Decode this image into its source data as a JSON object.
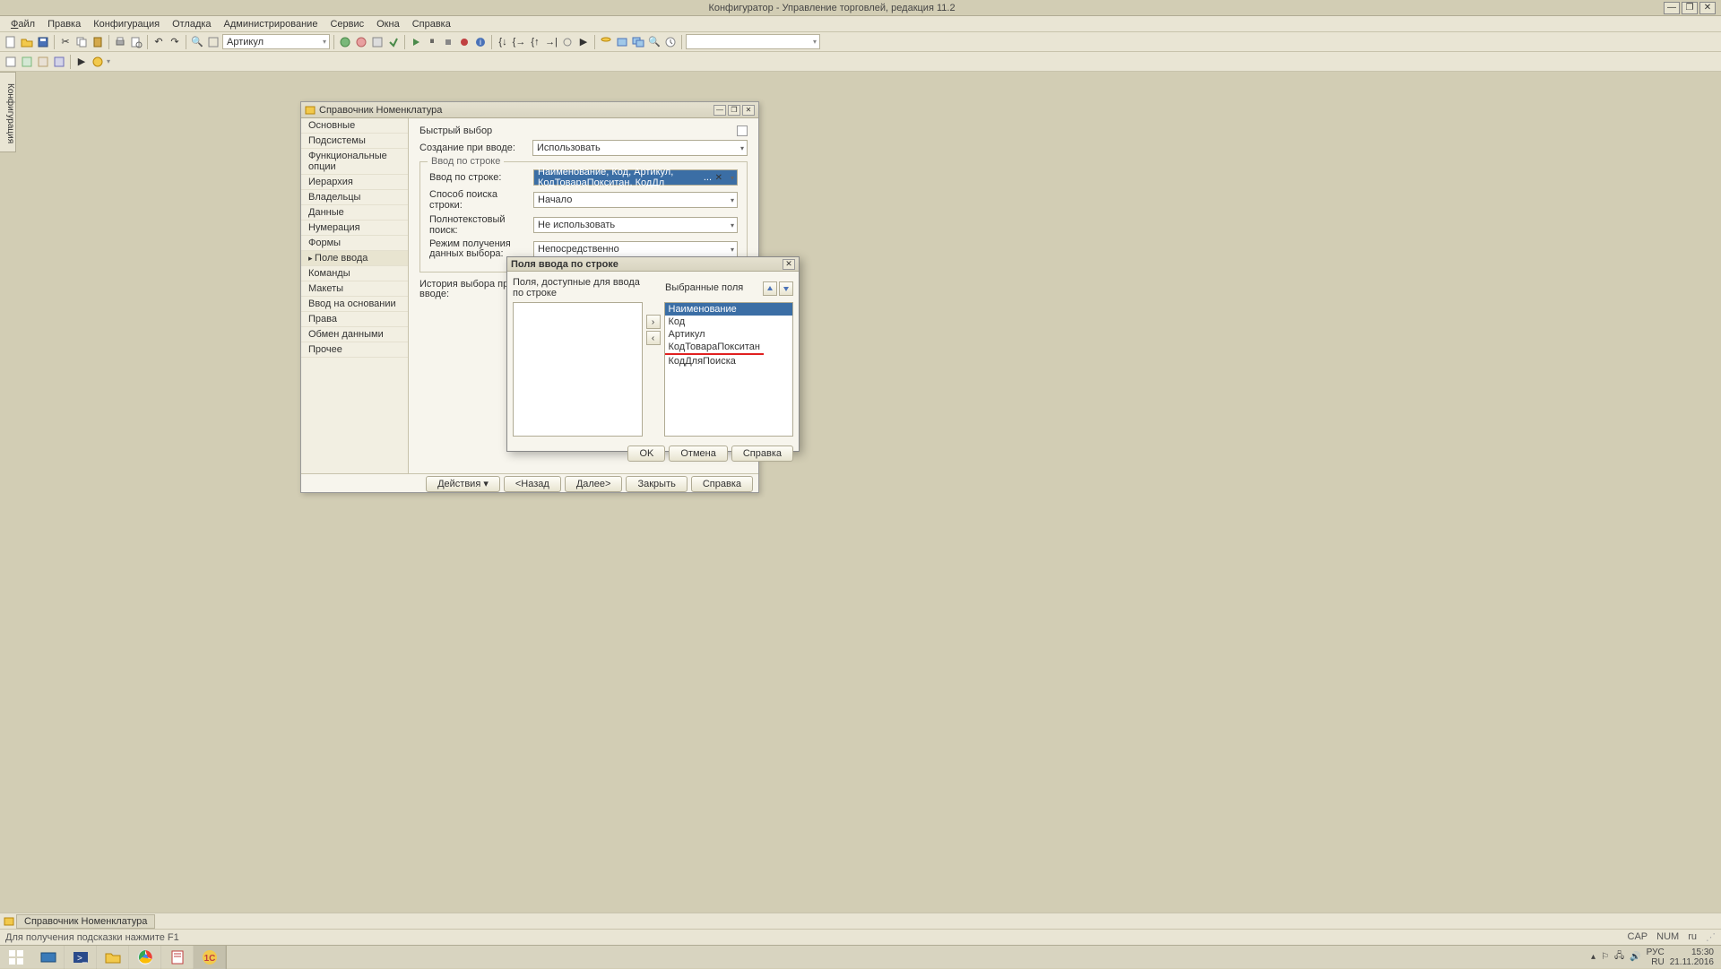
{
  "app": {
    "title": "Конфигуратор - Управление торговлей, редакция 11.2"
  },
  "menu": [
    "Файл",
    "Правка",
    "Конфигурация",
    "Отладка",
    "Администрирование",
    "Сервис",
    "Окна",
    "Справка"
  ],
  "toolbar": {
    "combo1": "Артикул"
  },
  "sideTab": "Конфигурация",
  "dlg1": {
    "title": "Справочник Номенклатура",
    "nav": [
      "Основные",
      "Подсистемы",
      "Функциональные опции",
      "Иерархия",
      "Владельцы",
      "Данные",
      "Нумерация",
      "Формы",
      "Поле ввода",
      "Команды",
      "Макеты",
      "Ввод на основании",
      "Права",
      "Обмен данными",
      "Прочее"
    ],
    "navActiveIndex": 8,
    "quickLabel": "Быстрый выбор",
    "createLabel": "Создание при вводе:",
    "createValue": "Использовать",
    "fs1": "Ввод по строке",
    "rowInputLabel": "Ввод по строке:",
    "rowInputValue": "Наименование, Код, Артикул, КодТовараПокситан, КодДл",
    "searchModeLabel": "Способ поиска строки:",
    "searchModeValue": "Начало",
    "fulltextLabel": "Полнотекстовый поиск:",
    "fulltextValue": "Не использовать",
    "dataModeLabel": "Режим получения данных выбора:",
    "dataModeValue": "Непосредственно",
    "historyLabel": "История выбора при вводе:",
    "footer": {
      "actions": "Действия",
      "back": "<Назад",
      "next": "Далее>",
      "close": "Закрыть",
      "help": "Справка"
    }
  },
  "dlg2": {
    "title": "Поля ввода по строке",
    "leftLabel": "Поля, доступные для ввода по строке",
    "rightLabel": "Выбранные поля",
    "rightItems": [
      "Наименование",
      "Код",
      "Артикул",
      "КодТовараПокситан",
      "КодДляПоиска"
    ],
    "selectedIndex": 0,
    "underlineIndex": 3,
    "ok": "OK",
    "cancel": "Отмена",
    "help": "Справка"
  },
  "openTab": "Справочник Номенклатура",
  "status": {
    "hint": "Для получения подсказки нажмите F1",
    "cap": "CAP",
    "num": "NUM",
    "lang": "ru"
  },
  "tray": {
    "lang1": "РУС",
    "lang2": "RU",
    "time": "15:30",
    "date": "21.11.2016"
  }
}
